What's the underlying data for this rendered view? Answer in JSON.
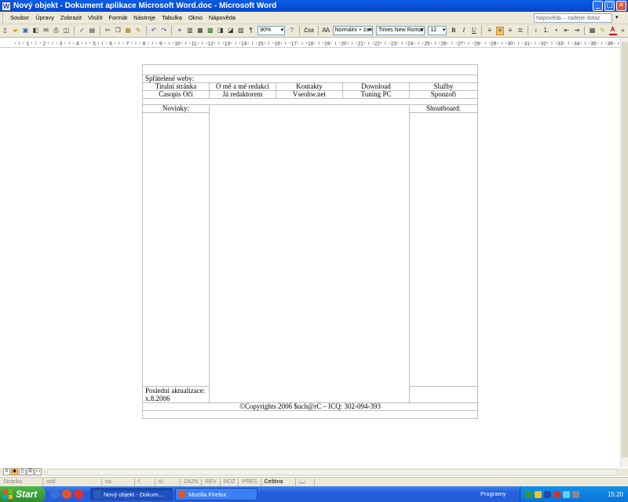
{
  "window": {
    "title": "Nový objekt - Dokument aplikace Microsoft Word.doc - Microsoft Word",
    "app_icon": "W",
    "buttons": [
      "_",
      "□",
      "✕"
    ]
  },
  "menu": {
    "items": [
      "Soubor",
      "Úpravy",
      "Zobrazit",
      "Vložit",
      "Formát",
      "Nástroje",
      "Tabulka",
      "Okno",
      "Nápověda"
    ],
    "help_placeholder": "Nápověda – zadejte dotaz"
  },
  "toolbar": {
    "zoom": "90%",
    "read_label": "Číst",
    "style": "Normální + zarc",
    "font": "Times New Roman",
    "size": "12",
    "bold": "B",
    "italic": "I",
    "underline": "U",
    "font_color": "A"
  },
  "ruler": {
    "labels": [
      "1",
      "2",
      "3",
      "4",
      "5",
      "6",
      "7",
      "8",
      "9",
      "10",
      "11",
      "12",
      "13",
      "14",
      "15",
      "16",
      "17",
      "18",
      "19",
      "20",
      "21",
      "22",
      "23",
      "24",
      "25",
      "26",
      "27",
      "28",
      "29",
      "30",
      "31",
      "32",
      "33",
      "34",
      "35",
      "36"
    ]
  },
  "document": {
    "friends_label": "Spřátelené weby:",
    "nav_row1": [
      "Titulní stránka",
      "O mě a mé redakci",
      "Kontakty",
      "Download",
      "Služby"
    ],
    "nav_row2": [
      "Časopis Oči",
      "Já redaktorem",
      "Vseohw.net",
      "Tuning PC",
      "Sponzoři"
    ],
    "news_label": "Novinky:",
    "shoutboard_label": "Shoutboard:",
    "last_update_label": "Poslední aktualizace:",
    "last_update_date": "x.8.2006",
    "copyright": "©Copyrights 2006 $uch@rC – ICQ: 302-094-393"
  },
  "statusbar": {
    "page": "Stránka",
    "section": "odd",
    "at": "na",
    "line": "ř.",
    "col": "sl.",
    "rec": "ZÁZN",
    "trk": "REV",
    "ext": "ROZ",
    "ovr": "PŘES",
    "language": "Čeština"
  },
  "taskbar": {
    "start": "Start",
    "tasks": [
      "Nový objekt - Dokum...",
      "Mozilla Firefox"
    ],
    "programs": "Programy",
    "clock": "15:20"
  },
  "colors": {
    "title_bar": "#0a5de6",
    "chrome": "#ece9d8",
    "taskbar": "#245edb",
    "start_button": "#2f8b2f",
    "tray": "#0c73d6",
    "table_border": "#bdbdbd"
  }
}
